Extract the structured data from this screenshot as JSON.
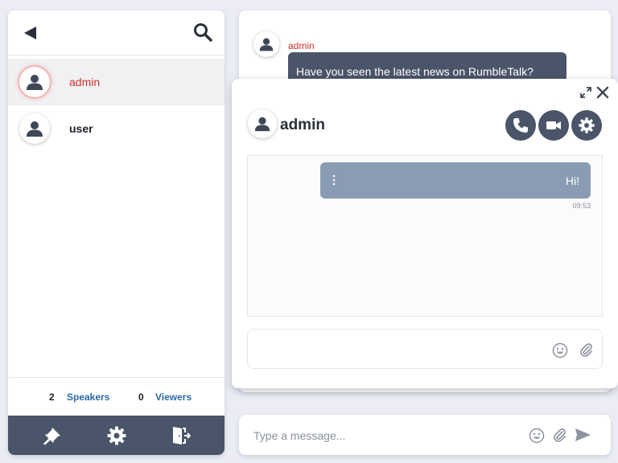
{
  "colors": {
    "toolbar": "#4a5569",
    "accent_red": "#d0322d",
    "link_blue": "#2b6aa8",
    "bubble_mine": "#8a9bb4"
  },
  "user_panel": {
    "header": {
      "back_icon": "back-triangle-icon",
      "search_icon": "search-icon"
    },
    "users": [
      {
        "name": "admin",
        "active": true,
        "icon": "user-avatar-icon"
      },
      {
        "name": "user",
        "active": false,
        "icon": "user-avatar-icon"
      }
    ],
    "counts": {
      "speakers_count": "2",
      "speakers_label": "Speakers",
      "viewers_count": "0",
      "viewers_label": "Viewers"
    },
    "toolbar_icons": [
      "pin-icon",
      "gear-icon",
      "exit-door-icon"
    ]
  },
  "main_chat": {
    "messages": [
      {
        "author": "admin",
        "text": "Have you seen the latest news on RumbleTalk?"
      }
    ]
  },
  "composer": {
    "placeholder": "Type a message...",
    "icons": [
      "emoji-icon",
      "attach-icon",
      "send-icon"
    ]
  },
  "private_chat": {
    "title": "admin",
    "actions": [
      "phone-icon",
      "video-icon",
      "gear-icon"
    ],
    "window_icons": [
      "expand-icon",
      "close-icon"
    ],
    "messages": [
      {
        "text": "Hi!",
        "time": "09:53",
        "mine": true
      }
    ],
    "composer": {
      "placeholder": "",
      "icons": [
        "emoji-icon",
        "attach-icon"
      ]
    }
  }
}
